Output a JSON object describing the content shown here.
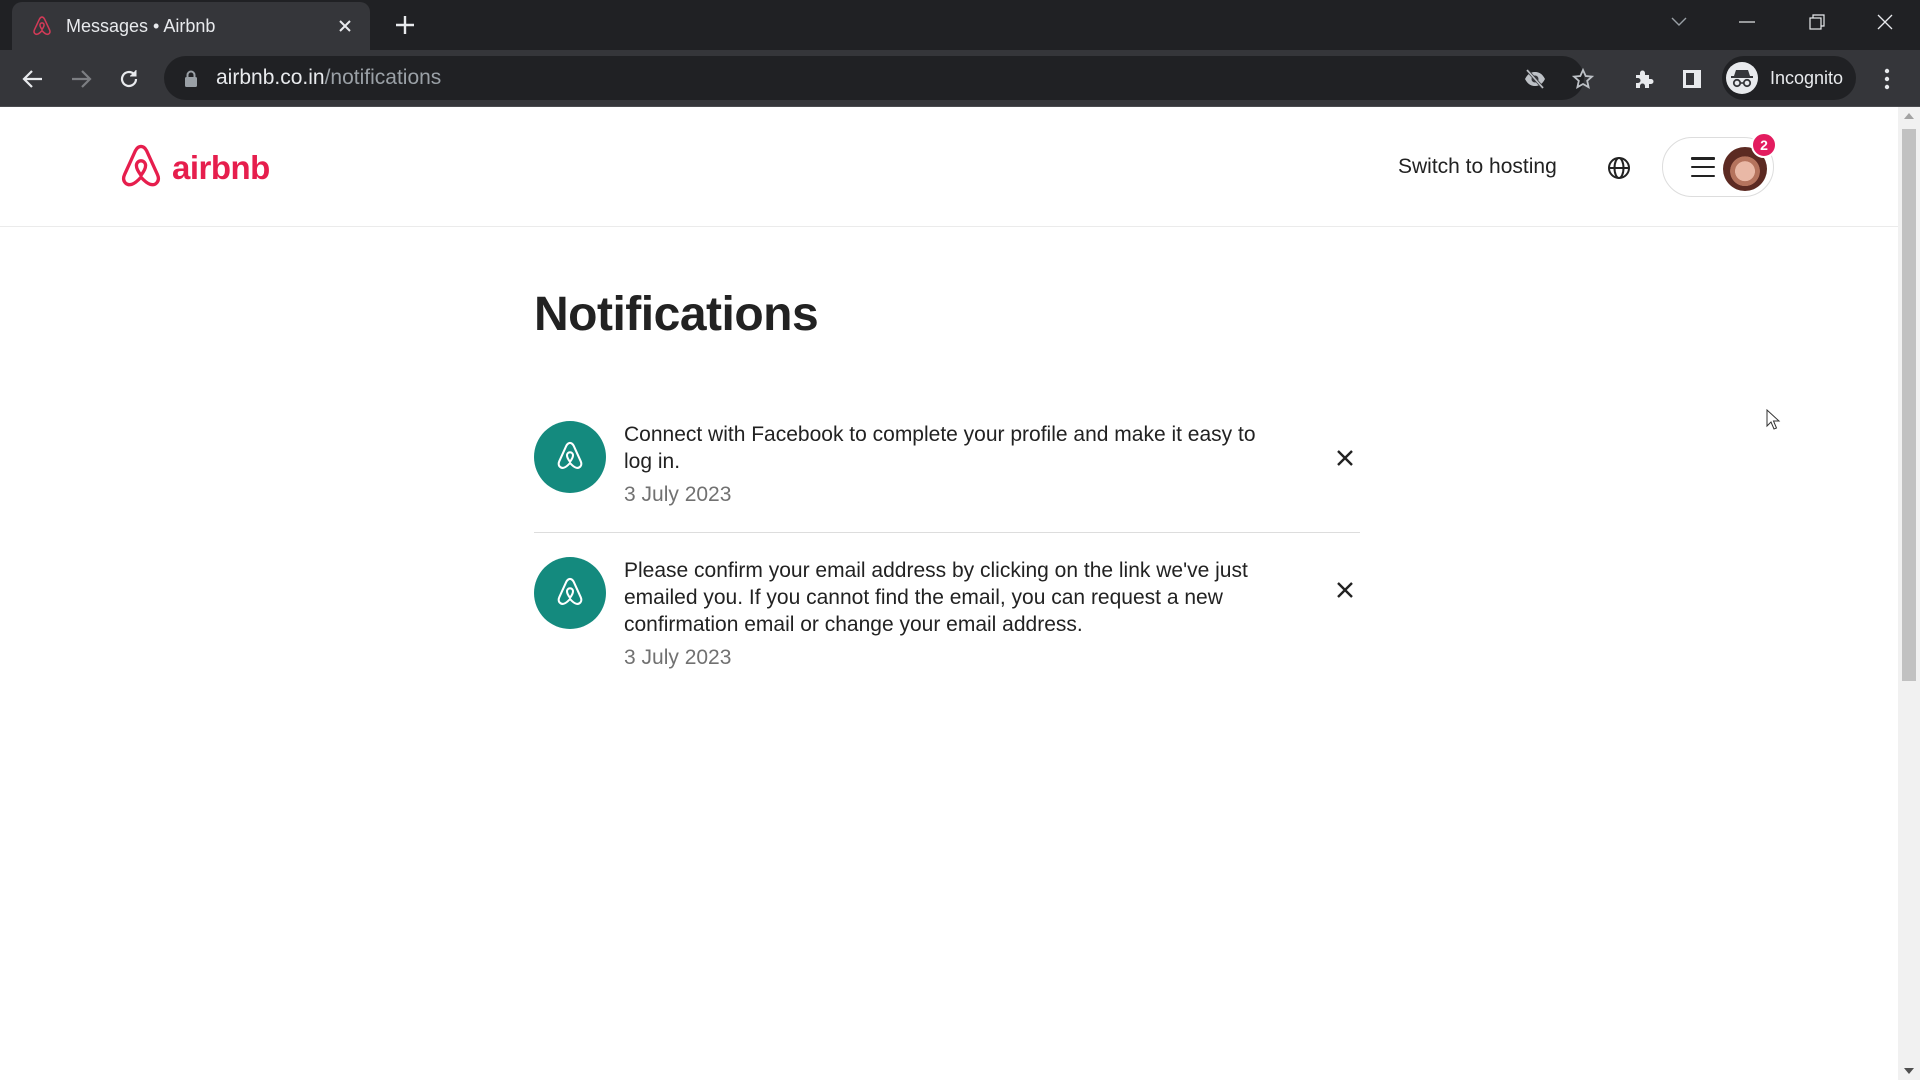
{
  "browser": {
    "tab": {
      "title": "Messages • Airbnb",
      "favicon": "airbnb-favicon"
    },
    "url": {
      "domain": "airbnb.co.in",
      "path": "/notifications"
    },
    "profile_label": "Incognito",
    "icons": {
      "back": "back-arrow-icon",
      "forward": "forward-arrow-icon",
      "reload": "reload-icon",
      "lock": "lock-icon",
      "tracking": "eye-slash-icon",
      "bookmark": "star-icon",
      "extensions": "puzzle-icon",
      "side_panel": "side-panel-icon",
      "menu": "kebab-menu-icon"
    }
  },
  "site": {
    "brand_name": "airbnb",
    "brand_color": "#e61e4d",
    "header": {
      "switch_hosting_label": "Switch to hosting",
      "notification_badge_count": "2",
      "badge_color": "#e31c5f"
    },
    "page_title": "Notifications",
    "notification_icon_color": "#148a7e",
    "notifications": [
      {
        "text": "Connect with Facebook to complete your profile and make it easy to log in.",
        "date": "3 July 2023"
      },
      {
        "text": "Please confirm your email address by clicking on the link we've just emailed you. If you cannot find the email, you can request a new confirmation email or change your email address.",
        "date": "3 July 2023"
      }
    ]
  }
}
